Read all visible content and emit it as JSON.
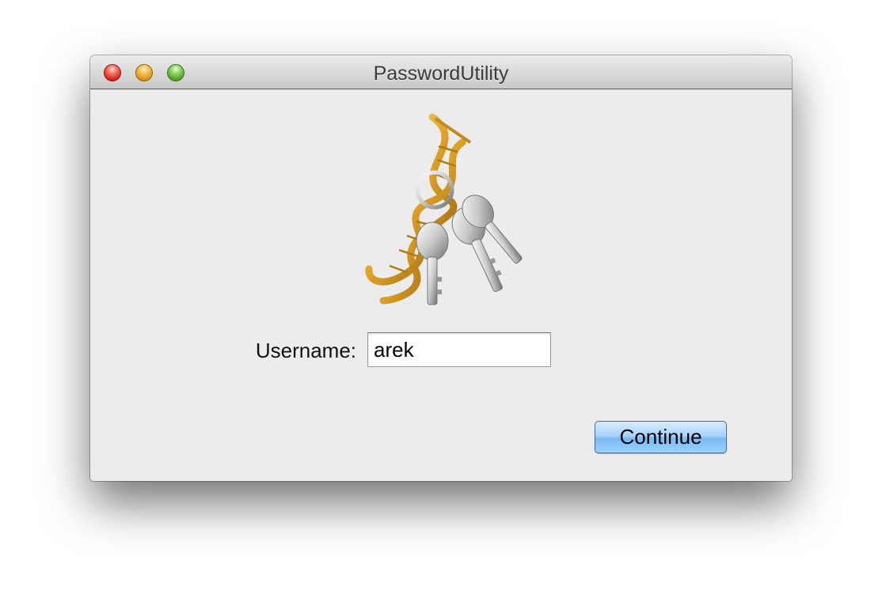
{
  "window": {
    "title": "PasswordUtility"
  },
  "traffic_lights": {
    "close": {
      "icon": "close-icon",
      "color": "#d8291c"
    },
    "minimize": {
      "icon": "minimize-icon",
      "color": "#e0951a"
    },
    "zoom": {
      "icon": "zoom-icon",
      "color": "#53a52c"
    }
  },
  "logo": {
    "icon": "keychain-dna-keys-icon"
  },
  "form": {
    "username_label": "Username:",
    "username_value": "arek"
  },
  "actions": {
    "continue_label": "Continue",
    "accent": "#7ab9f2"
  }
}
